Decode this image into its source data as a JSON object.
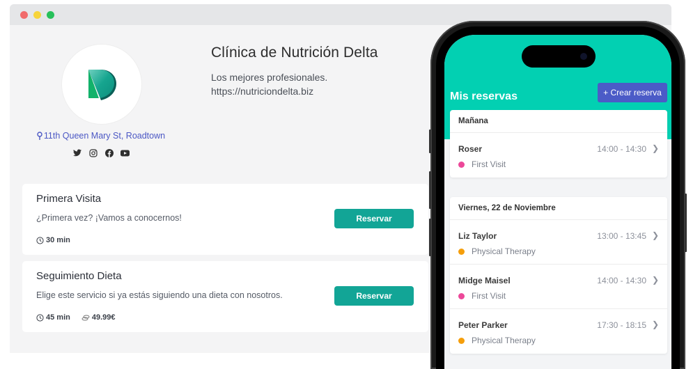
{
  "window": {
    "controls": [
      "close",
      "minimize",
      "maximize"
    ]
  },
  "profile": {
    "logo": "delta-logo",
    "address": "11th Queen Mary St, Roadtown",
    "address_icon": "map-pin-icon",
    "socials": [
      {
        "name": "twitter",
        "icon": "twitter-icon"
      },
      {
        "name": "instagram",
        "icon": "instagram-icon"
      },
      {
        "name": "facebook",
        "icon": "facebook-icon"
      },
      {
        "name": "youtube",
        "icon": "youtube-icon"
      }
    ]
  },
  "clinic": {
    "title": "Clínica de Nutrición Delta",
    "tagline": "Los mejores profesionales.",
    "website": "https://nutriciondelta.biz"
  },
  "services": [
    {
      "name": "Primera Visita",
      "description": "¿Primera vez? ¡Vamos a conocernos!",
      "duration": "30 min",
      "price": null,
      "button_label": "Reservar"
    },
    {
      "name": "Seguimiento Dieta",
      "description": "Elige este servicio si ya estás siguiendo una dieta con nosotros.",
      "duration": "45 min",
      "price": "49.99€",
      "button_label": "Reservar"
    }
  ],
  "phone_app": {
    "title": "Mis reservas",
    "create_button": "+ Crear reserva",
    "groups": [
      {
        "day": "Mañana",
        "bookings": [
          {
            "client": "Roser",
            "time": "14:00 - 14:30",
            "service": "First Visit",
            "color": "#ec4899"
          }
        ]
      },
      {
        "day": "Viernes, 22 de Noviembre",
        "bookings": [
          {
            "client": "Liz Taylor",
            "time": "13:00 - 13:45",
            "service": "Physical Therapy",
            "color": "#f59e0b"
          },
          {
            "client": "Midge Maisel",
            "time": "14:00 - 14:30",
            "service": "First Visit",
            "color": "#ec4899"
          },
          {
            "client": "Peter Parker",
            "time": "17:30 - 18:15",
            "service": "Physical Therapy",
            "color": "#f59e0b"
          }
        ]
      }
    ]
  },
  "colors": {
    "brand_teal": "#02d0b2",
    "button_teal": "#12a596",
    "accent_blue": "#4b5bc7",
    "link_blue": "#4b57c4"
  }
}
